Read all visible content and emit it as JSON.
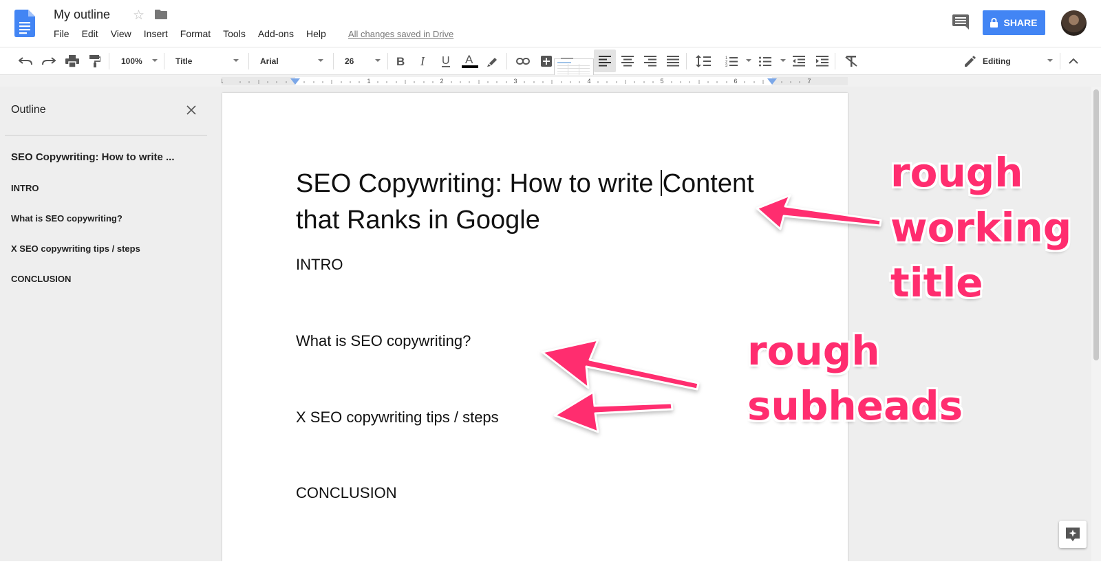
{
  "header": {
    "doc_title": "My outline",
    "menu": [
      "File",
      "Edit",
      "View",
      "Insert",
      "Format",
      "Tools",
      "Add-ons",
      "Help"
    ],
    "saved_status": "All changes saved in Drive",
    "share_label": "SHARE"
  },
  "toolbar": {
    "zoom": "100%",
    "style": "Title",
    "font": "Arial",
    "font_size": "26",
    "mode": "Editing"
  },
  "ruler": {
    "numbers": [
      "1",
      "1",
      "2",
      "3",
      "4",
      "5",
      "6",
      "7"
    ]
  },
  "outline": {
    "title": "Outline",
    "items": [
      "SEO Copywriting: How to write ...",
      "INTRO",
      "What is SEO copywriting?",
      "X SEO copywriting tips / steps",
      "CONCLUSION"
    ]
  },
  "document": {
    "title_line1_before_cursor": "SEO Copywriting: How to write ",
    "title_line1_after_cursor": "Content",
    "title_line2": "that Ranks in Google",
    "lines": [
      "INTRO",
      "What is SEO copywriting?",
      "X SEO copywriting tips / steps",
      "CONCLUSION"
    ]
  },
  "annotations": {
    "title_note": [
      "rough",
      "working",
      "title"
    ],
    "subhead_note": [
      "rough",
      "subheads"
    ],
    "color": "#ff2d6f"
  },
  "colors": {
    "share_button": "#4285f4",
    "docs_blue": "#4285f4"
  }
}
